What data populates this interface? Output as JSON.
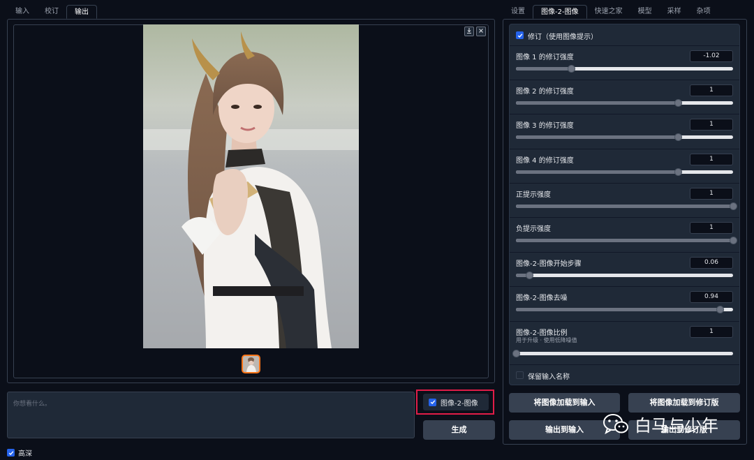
{
  "left_tabs": [
    "输入",
    "校订",
    "输出"
  ],
  "left_active_tab": 2,
  "right_tabs": [
    "设置",
    "图像-2-图像",
    "快速之家",
    "模型",
    "采样",
    "杂项"
  ],
  "right_active_tab": 1,
  "gallery": {
    "download_icon": "download-icon",
    "close_icon": "close-icon"
  },
  "prompt": {
    "placeholder": "你想看什么。"
  },
  "image2image_checkbox": {
    "label": "图像-2-图像",
    "checked": true
  },
  "generate_button": "生成",
  "high_depth": {
    "label": "高深",
    "checked": true
  },
  "revision": {
    "label": "修订（使用图像提示）",
    "checked": true
  },
  "sliders": [
    {
      "label": "图像 1 的修订强度",
      "value": "-1.02",
      "level": 0.255
    },
    {
      "label": "图像 2 的修订强度",
      "value": "1",
      "level": 0.745
    },
    {
      "label": "图像 3 的修订强度",
      "value": "1",
      "level": 0.745
    },
    {
      "label": "图像 4 的修订强度",
      "value": "1",
      "level": 0.745
    },
    {
      "label": "正提示强度",
      "value": "1",
      "level": 1.0
    },
    {
      "label": "负提示强度",
      "value": "1",
      "level": 1.0
    },
    {
      "label": "图像-2-图像开始步骤",
      "value": "0.06",
      "level": 0.06
    },
    {
      "label": "图像-2-图像去噪",
      "value": "0.94",
      "level": 0.94
    },
    {
      "label": "图像-2-图像比例",
      "sublabel": "用于升级 · 使用低降噪值",
      "value": "1",
      "level": 0.0
    }
  ],
  "keep_input_names": {
    "label": "保留输入名称",
    "checked": false
  },
  "buttons": {
    "load_to_input": "将图像加载到输入",
    "load_to_revision": "将图像加载到修订版",
    "output_to_input": "输出到输入",
    "output_to_revision": "输出到修订版"
  },
  "watermark": {
    "text": "白马与少年",
    "icon": "wechat-icon"
  }
}
